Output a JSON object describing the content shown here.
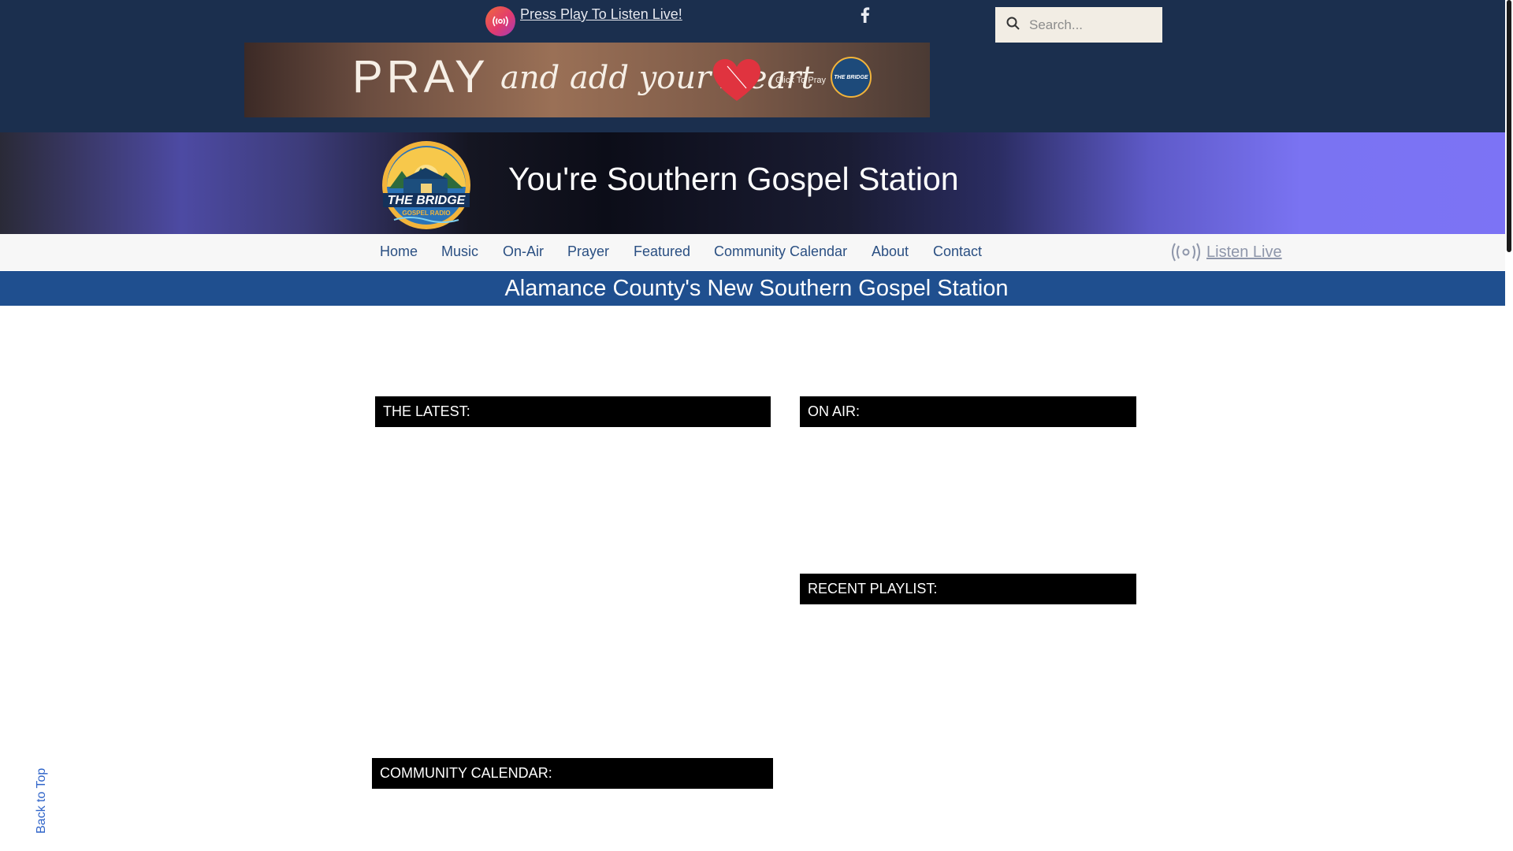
{
  "topbar": {
    "live_label": "Press Play To Listen Live!",
    "live_icon": "broadcast-icon",
    "social_icon": "facebook-icon",
    "search_placeholder": "Search..."
  },
  "banner": {
    "word1": "PRAY",
    "word2": "and add your Heart",
    "cta": "Click To Pray",
    "logo_text": "THE BRIDGE"
  },
  "hero": {
    "logo_line1": "THE BRIDGE",
    "logo_line2": "GOSPEL RADIO",
    "title": "You're Southern Gospel Station"
  },
  "nav": {
    "items": [
      "Home",
      "Music",
      "On-Air",
      "Prayer",
      "Featured",
      "Community Calendar",
      "About",
      "Contact"
    ],
    "listen_live": "Listen Live"
  },
  "strip": {
    "text": "Alamance County's New Southern Gospel Station"
  },
  "sections": {
    "latest": "THE LATEST:",
    "on_air": "ON AIR:",
    "recent_playlist": "RECENT PLAYLIST:",
    "community_calendar": "COMMUNITY CALENDAR:"
  },
  "back_to_top": "Back to Top",
  "colors": {
    "topbar": "#1b2f4e",
    "nav_link": "#2a4f82",
    "strip": "#1f4f8f",
    "section_header": "#000000"
  }
}
